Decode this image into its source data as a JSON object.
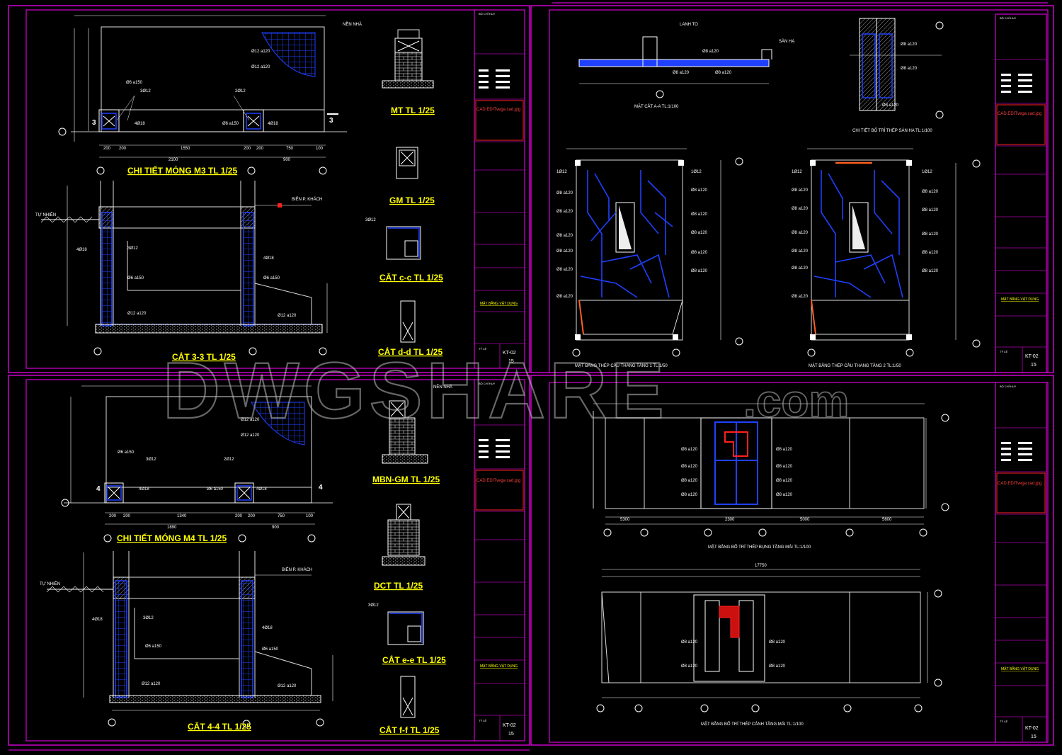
{
  "colors": {
    "background": "#000000",
    "frame": "#ff00ff",
    "rebar": "#2040ff",
    "text": "#ffffff",
    "title": "#ffff00",
    "stamp": "#ff2020"
  },
  "watermark": {
    "main": "DWGSHARE",
    "suffix": ".com"
  },
  "sheets": [
    {
      "titles": {
        "mt": "MT TL 1/25",
        "gm": "GM TL 1/25",
        "mong": "CHI TIẾT MÓNG M3 TL 1/25",
        "cat": "CẮT 3-3 TL 1/25",
        "cc": "CẮT c-c TL 1/25",
        "dd": "CẮT d-d TL 1/25"
      },
      "notes": {
        "tu_nhien": "TỰ NHIÊN",
        "nen_nha": "NỀN NHÀ",
        "bien": "BIÊN P. KHÁCH"
      },
      "dims_top": [
        "200",
        "200",
        "1550",
        "200",
        "200",
        "750",
        "100"
      ],
      "dims_bottom": [
        "2100",
        "900"
      ],
      "section_mark": "3",
      "code": "KT-02",
      "sheet_no": "15"
    },
    {
      "titles": {
        "mt": "MBN-GM TL 1/25",
        "gm": "DCT TL 1/25",
        "mong": "CHI TIẾT MÓNG M4 TL 1/25",
        "cat": "CẮT 4-4 TL 1/25",
        "cc": "CẮT e-e TL 1/25",
        "dd": "CẮT f-f TL 1/25"
      },
      "notes": {
        "tu_nhien": "TỰ NHIÊN",
        "nen_nha": "NỀN NHÀ",
        "bien": "BIÊN P. KHÁCH"
      },
      "dims_top": [
        "200",
        "200",
        "1340",
        "200",
        "200",
        "750",
        "100"
      ],
      "dims_bottom": [
        "1890",
        "900"
      ],
      "section_mark": "4",
      "code": "KT-02",
      "sheet_no": "15"
    },
    {
      "titles": {
        "a": "MẶT CẮT A-A  TL:1/100",
        "b": "CHI TIẾT BỐ TRÍ THÉP SÀN HA  TL:1/100",
        "c": "MẶT BẰNG THÉP CẦU THANG TẦNG 1  TL:1/50",
        "d": "MẶT BẰNG THÉP CẦU THANG TẦNG 2  TL:1/50"
      },
      "labels": {
        "lanh_to": "LANH TO",
        "san_ha": "SÀN HẠ"
      },
      "code": "KT-02",
      "sheet_no": "15"
    },
    {
      "titles": {
        "a": "MẶT BẰNG BỐ TRÍ THÉP BỤNG TẦNG MÁI  TL:1/100",
        "b": "MẶT BẰNG BỐ TRÍ THÉP CÁNH TẦNG MÁI  TL:1/100"
      },
      "dims_a": [
        "5300",
        "2300",
        "5000",
        "5600"
      ],
      "dims_b": [
        "17750"
      ],
      "code": "KT-02",
      "sheet_no": "15"
    }
  ],
  "rebar_labels": {
    "r1": "1Ø12",
    "r2": "Ø12 a120",
    "r3": "3Ø12",
    "r4": "4Ø18",
    "r5": "Ø6 a150",
    "r6": "Ø8 a120",
    "r7": "Ø12 a120",
    "r8": "2Ø12"
  },
  "titleblock": {
    "approval": "BỘ CHỈ HUY",
    "stamp": "CAD.EDITvega cad.jpg",
    "sheet_name": "MẶT BẰNG VẬT DỤNG",
    "scale": "TỶ LỆ"
  }
}
